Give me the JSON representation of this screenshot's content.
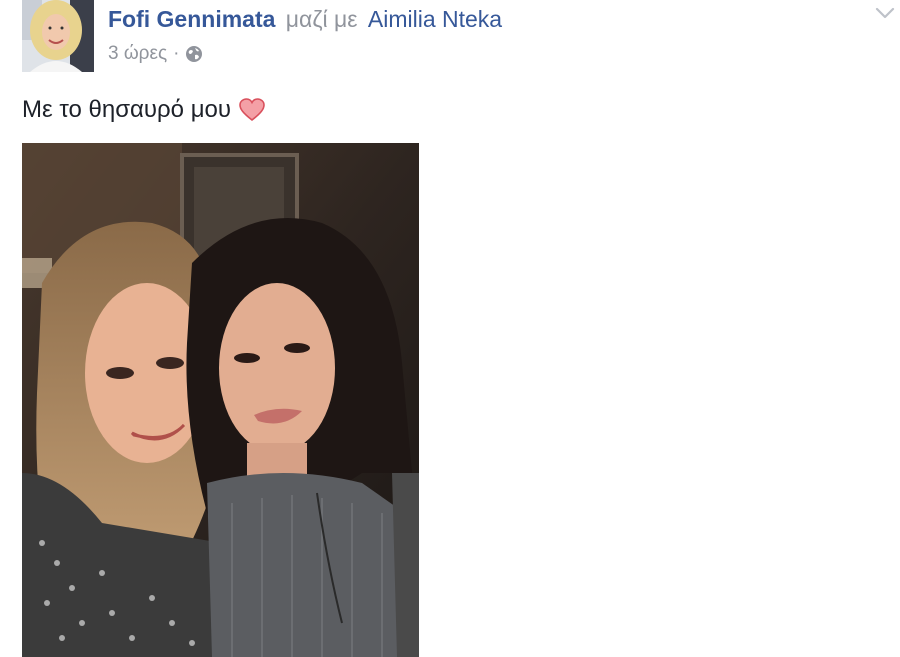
{
  "post": {
    "author": "Fofi Gennimata",
    "with_text": "μαζί με",
    "tagged_person": "Aimilia Nteka",
    "timestamp": "3 ώρες",
    "meta_separator": "·",
    "privacy_icon": "globe-icon",
    "options_icon": "chevron-down-icon",
    "text": "Με το θησαυρό μου",
    "text_emoji": "heart-icon",
    "photo_icon": "photo"
  },
  "colors": {
    "link_blue": "#365899",
    "meta_gray": "#90949c",
    "text_dark": "#1d2129",
    "heart_red": "#e8606a"
  }
}
